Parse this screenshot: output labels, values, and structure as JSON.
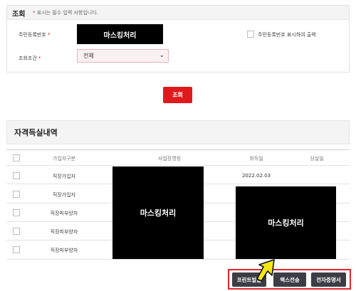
{
  "search": {
    "title": "조회",
    "required_note": "표시는 필수 입력 사항입니다.",
    "required_mark": "*",
    "resident_label": "주민등록번호",
    "resident_value_masked": "마스킹처리",
    "condition_label": "조회조건",
    "condition_value": "전체",
    "print_option_label": "주민등록번호 표시하여 출력",
    "search_button": "조회"
  },
  "results": {
    "title": "자격득실내역",
    "columns": [
      "가입자구분",
      "사업장명칭",
      "취득일",
      "상실일"
    ],
    "rows": [
      {
        "type": "직장가입자",
        "acquired": "2022.02.03",
        "lost": ""
      },
      {
        "type": "직장가입자",
        "acquired": "",
        "lost": ""
      },
      {
        "type": "직장피부양자",
        "acquired": "",
        "lost": ""
      },
      {
        "type": "직장피부양자",
        "acquired": "",
        "lost": ""
      },
      {
        "type": "직장피부양자",
        "acquired": "",
        "lost": ""
      }
    ],
    "mask_company": "마스킹처리",
    "mask_dates": "마스킹처리"
  },
  "actions": {
    "print": "프린트발급",
    "fax": "팩스전송",
    "ecert": "전자증명서"
  },
  "colors": {
    "accent_red": "#e0191d",
    "dark_button": "#3c3d45",
    "arrow_yellow": "#f5e614"
  }
}
